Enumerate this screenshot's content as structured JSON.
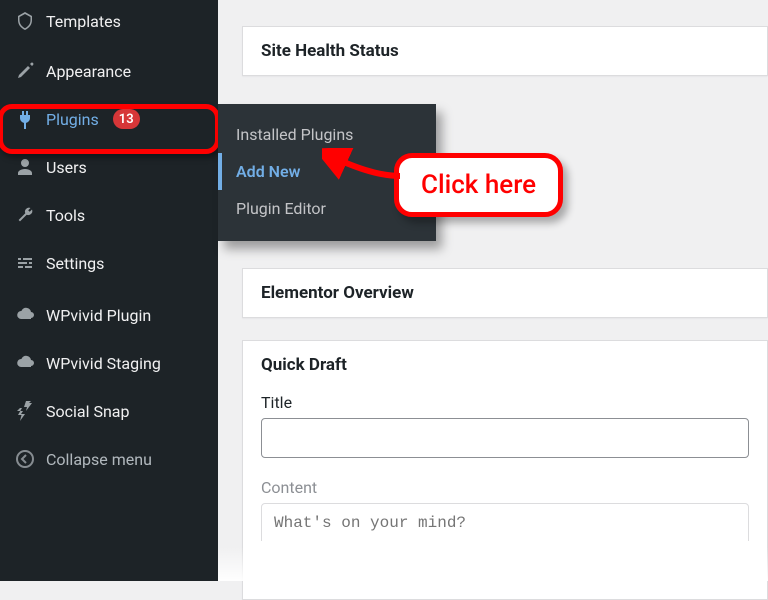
{
  "sidebar": {
    "items": [
      {
        "label": "Templates"
      },
      {
        "label": "Appearance"
      },
      {
        "label": "Plugins",
        "badge": "13"
      },
      {
        "label": "Users"
      },
      {
        "label": "Tools"
      },
      {
        "label": "Settings"
      },
      {
        "label": "WPvivid Plugin"
      },
      {
        "label": "WPvivid Staging"
      },
      {
        "label": "Social Snap"
      },
      {
        "label": "Collapse menu"
      }
    ]
  },
  "submenu": {
    "items": [
      {
        "label": "Installed Plugins"
      },
      {
        "label": "Add New"
      },
      {
        "label": "Plugin Editor"
      }
    ]
  },
  "main": {
    "site_health_title": "Site Health Status",
    "elementor_title": "Elementor Overview",
    "quick_draft_title": "Quick Draft",
    "title_label": "Title",
    "content_label": "Content",
    "content_placeholder": "What's on your mind?"
  },
  "callout": {
    "text": "Click here"
  }
}
